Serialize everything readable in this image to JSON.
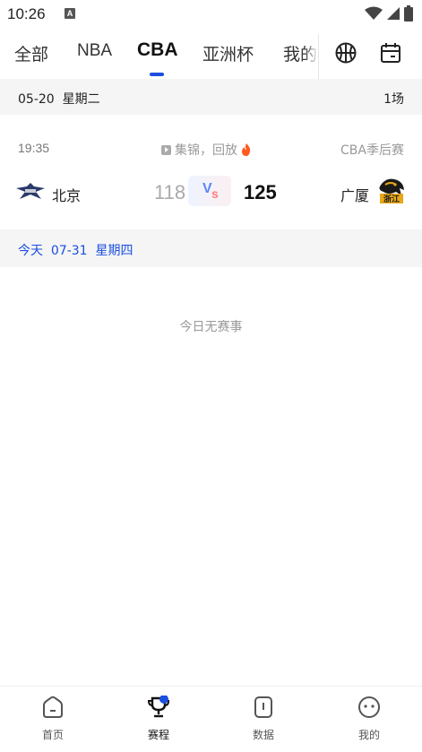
{
  "status_bar": {
    "time": "10:26",
    "notification_glyph": "A"
  },
  "tabs": [
    {
      "label": "全部",
      "active": false
    },
    {
      "label": "NBA",
      "active": false
    },
    {
      "label": "CBA",
      "active": true
    },
    {
      "label": "亚洲杯",
      "active": false
    },
    {
      "label": "我的",
      "active": false
    }
  ],
  "tab_icons": [
    "basketball-icon",
    "calendar-icon"
  ],
  "date_header": {
    "date": "05-20",
    "weekday": "星期二",
    "count": "1场"
  },
  "match": {
    "time": "19:35",
    "highlights": "集锦，回放",
    "stage": "CBA季后赛",
    "home": {
      "name": "北京",
      "score": "118"
    },
    "vs_v": "V",
    "vs_s": "s",
    "away": {
      "name": "广厦",
      "score": "125",
      "logo_text": "浙江"
    }
  },
  "today_header": {
    "label": "今天",
    "date": "07-31",
    "weekday": "星期四"
  },
  "empty_message": "今日无赛事",
  "bottom_nav": [
    {
      "label": "首页",
      "icon": "home-icon",
      "active": false
    },
    {
      "label": "赛程",
      "icon": "trophy-icon",
      "active": true
    },
    {
      "label": "数据",
      "icon": "data-icon",
      "active": false
    },
    {
      "label": "我的",
      "icon": "profile-icon",
      "active": false
    }
  ],
  "colors": {
    "accent": "#1a4fe0",
    "date_bar_bg": "#f5f5f5",
    "muted_text": "#999999",
    "fire": "#ff5a1f"
  }
}
